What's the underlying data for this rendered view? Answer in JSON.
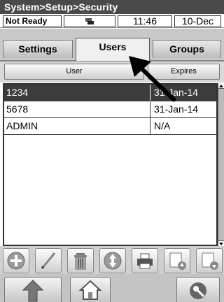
{
  "header": {
    "breadcrumb": "System>Setup>Security"
  },
  "status": {
    "state": "Not Ready",
    "time": "11:46",
    "date": "10-Dec"
  },
  "tabs": [
    {
      "label": "Settings",
      "active": false
    },
    {
      "label": "Users",
      "active": true
    },
    {
      "label": "Groups",
      "active": false
    }
  ],
  "table": {
    "columns": [
      "User",
      "Expires"
    ],
    "rows": [
      {
        "user": "1234",
        "expires": "31-Jan-14",
        "selected": true
      },
      {
        "user": "5678",
        "expires": "31-Jan-14",
        "selected": false
      },
      {
        "user": "ADMIN",
        "expires": "N/A",
        "selected": false
      }
    ]
  },
  "toolbar": {
    "buttons": [
      "add-icon",
      "edit-icon",
      "delete-icon",
      "sort-icon",
      "print-icon",
      "import-icon",
      "export-icon"
    ]
  },
  "nav": {
    "buttons": [
      "up-arrow-icon",
      "home-icon",
      "key-icon"
    ]
  },
  "colors": {
    "titlebar": "#4a4a4a",
    "selected_row": "#3c3c3c"
  }
}
